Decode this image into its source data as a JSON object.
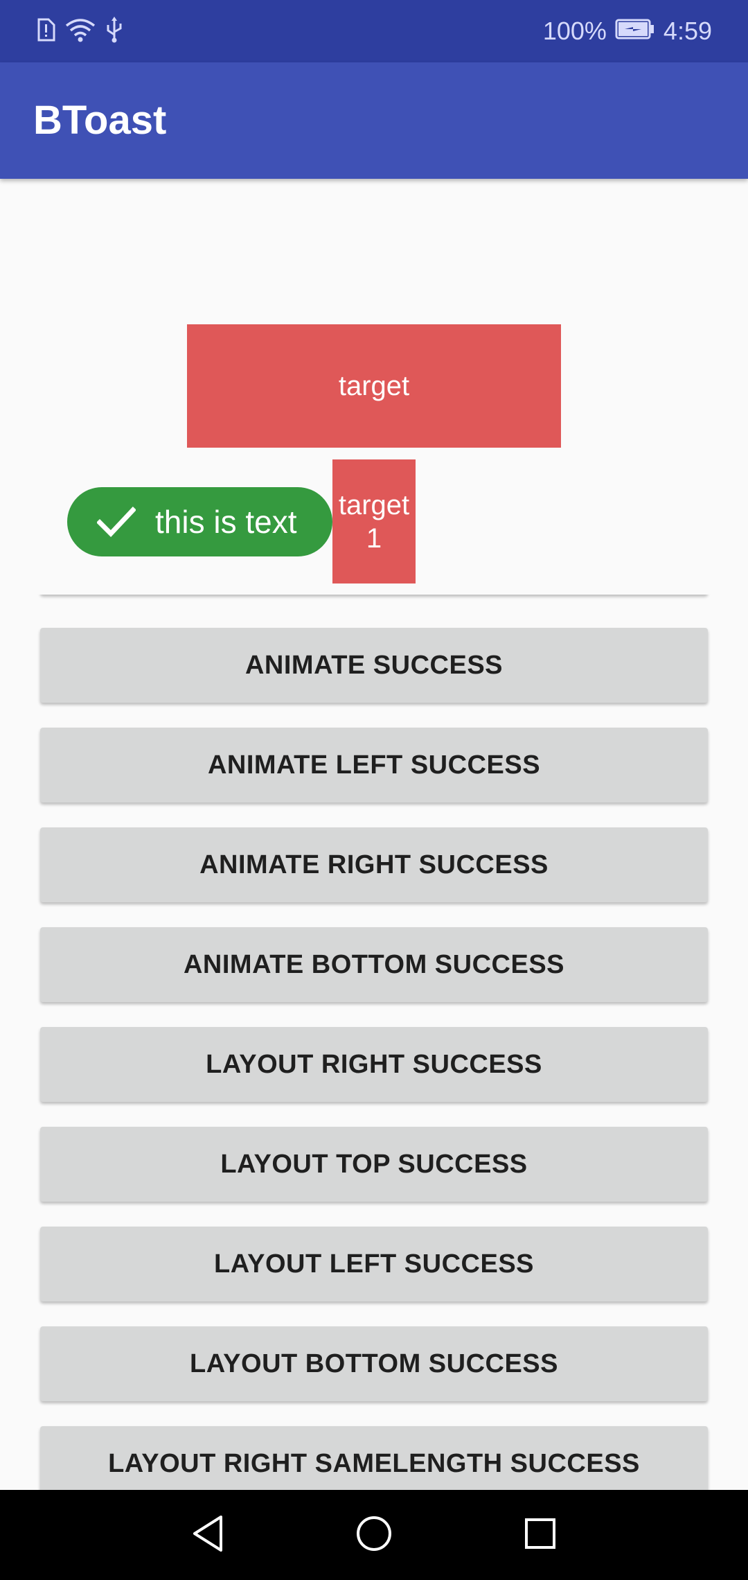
{
  "status_bar": {
    "battery_percent": "100%",
    "time": "4:59",
    "icons": [
      "sim-alert-icon",
      "wifi-icon",
      "usb-icon",
      "battery-charging-icon"
    ]
  },
  "app_bar": {
    "title": "BToast"
  },
  "targets": {
    "target_label": "target",
    "target1_line1": "target",
    "target1_line2": "1"
  },
  "toast": {
    "icon": "check-icon",
    "text": "this is text",
    "color": "#359a3f"
  },
  "buttons": [
    "ANIMATE SUCCESS",
    "ANIMATE LEFT SUCCESS",
    "ANIMATE RIGHT SUCCESS",
    "ANIMATE BOTTOM SUCCESS",
    "LAYOUT RIGHT SUCCESS",
    "LAYOUT TOP SUCCESS",
    "LAYOUT LEFT SUCCESS",
    "LAYOUT BOTTOM SUCCESS",
    "LAYOUT RIGHT SAMELENGTH SUCCESS"
  ],
  "nav_bar": {
    "icons": [
      "back-icon",
      "home-icon",
      "recents-icon"
    ]
  },
  "colors": {
    "status_bar": "#2e3e9f",
    "app_bar": "#3f51b5",
    "target": "#df5858",
    "button": "#d6d7d7"
  }
}
